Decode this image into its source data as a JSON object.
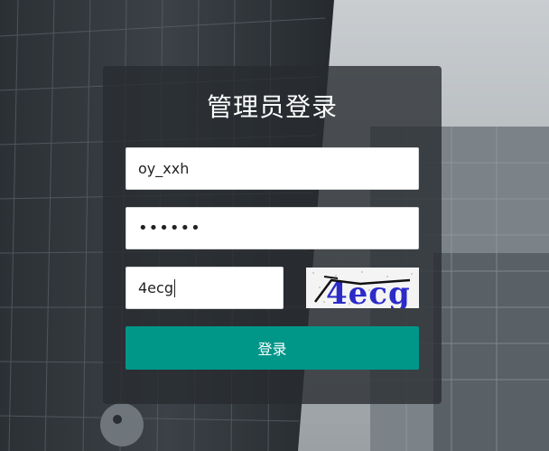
{
  "login": {
    "title": "管理员登录",
    "username_value": "oy_xxh",
    "password_value": "••••••",
    "captcha_value": "4ecg",
    "captcha_image_text": "4ecg",
    "submit_label": "登录"
  },
  "colors": {
    "button": "#009688",
    "panel": "#282c30"
  }
}
